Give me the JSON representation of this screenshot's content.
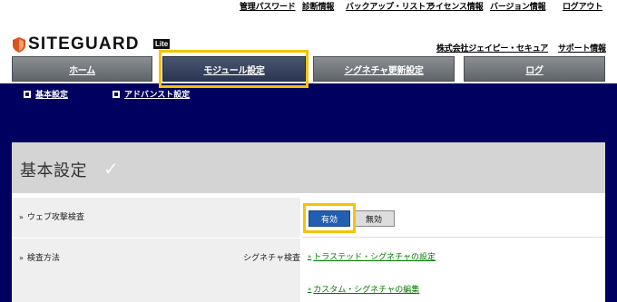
{
  "top_links": [
    "管理パスワード",
    "診断情報",
    "バックアップ・リストア",
    "ライセンス情報",
    "バージョン情報",
    "ログアウト"
  ],
  "logo": {
    "text": "SITEGUARD",
    "badge": "Lite"
  },
  "company_link": "株式会社ジェイピー・セキュア",
  "support_link": "サポート情報",
  "tabs": [
    "ホーム",
    "モジュール設定",
    "シグネチャ更新設定",
    "ログ"
  ],
  "active_tab": "モジュール設定",
  "subnav": [
    "基本設定",
    "アドバンスト設定"
  ],
  "panel": {
    "title": "基本設定",
    "rows": [
      {
        "label": "ウェブ攻撃検査",
        "value": ""
      },
      {
        "label": "検査方法",
        "value": "シグネチャ検査"
      }
    ],
    "toggle": {
      "on": "有効",
      "off": "無効",
      "selected": "有効"
    },
    "links": [
      "トラステッド・シグネチャの設定",
      "カスタム・シグネチャの編集"
    ]
  },
  "colors": {
    "navy": "#000060",
    "highlight": "#f4c400",
    "link_green": "#007a00",
    "button_blue": "#225fb0"
  }
}
